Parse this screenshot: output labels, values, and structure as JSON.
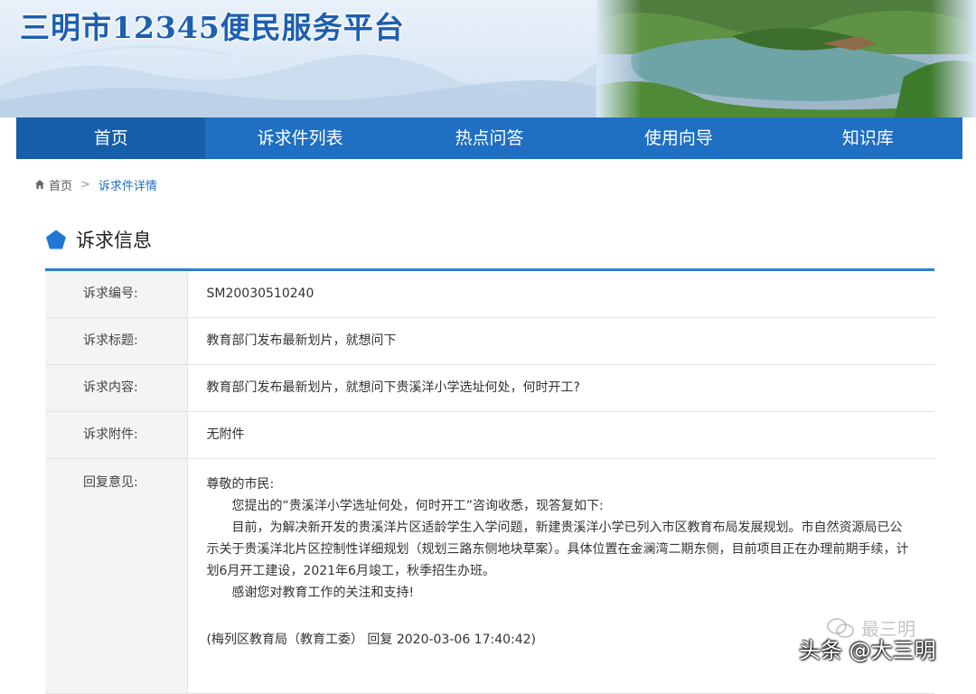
{
  "header": {
    "site_title": "三明市12345便民服务平台"
  },
  "nav": {
    "items": [
      {
        "label": "首页",
        "active": true
      },
      {
        "label": "诉求件列表",
        "active": false
      },
      {
        "label": "热点问答",
        "active": false
      },
      {
        "label": "使用向导",
        "active": false
      },
      {
        "label": "知识库",
        "active": false
      }
    ]
  },
  "breadcrumb": {
    "home": "首页",
    "current": "诉求件详情"
  },
  "section": {
    "title": "诉求信息"
  },
  "info": {
    "rows": [
      {
        "label": "诉求编号:",
        "value": "SM20030510240"
      },
      {
        "label": "诉求标题:",
        "value": "教育部门发布最新划片，就想问下"
      },
      {
        "label": "诉求内容:",
        "value": "教育部门发布最新划片，就想问下贵溪洋小学选址何处，何时开工?"
      },
      {
        "label": "诉求附件:",
        "value": "无附件"
      }
    ],
    "reply": {
      "label": "回复意见:",
      "greeting": "尊敬的市民:",
      "p1": "您提出的“贵溪洋小学选址何处，何时开工”咨询收悉，现答复如下:",
      "p2": "目前，为解决新开发的贵溪洋片区适龄学生入学问题，新建贵溪洋小学已列入市区教育布局发展规划。市自然资源局已公示关于贵溪洋北片区控制性详细规划（规划三路东侧地块草案）。具体位置在金澜湾二期东侧，目前项目正在办理前期手续，计划6月开工建设，2021年6月竣工，秋季招生办班。",
      "p3": "感谢您对教育工作的关注和支持!",
      "signature": "(梅列区教育局（教育工委） 回复 2020-03-06 17:40:42)"
    }
  },
  "watermark": {
    "faint": "最三明",
    "main": "头条 @大三明"
  },
  "colors": {
    "nav_bg": "#1f6fc3",
    "nav_active": "#165ea9",
    "accent": "#2a7fd4"
  }
}
